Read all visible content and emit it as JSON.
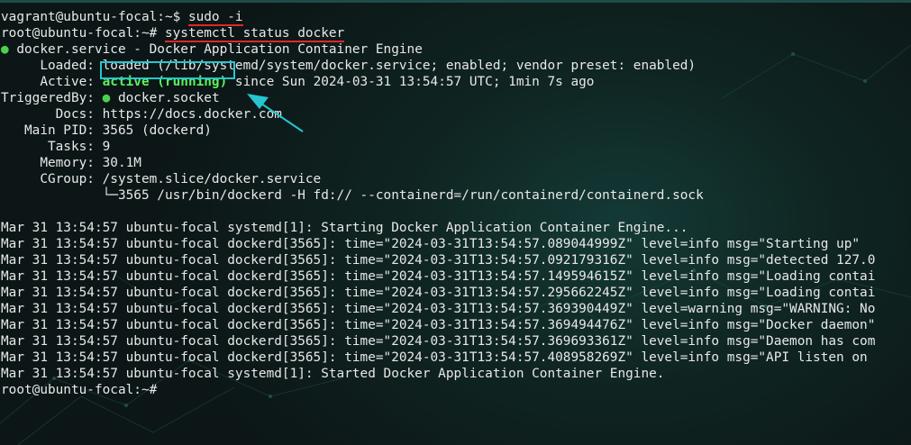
{
  "terminal": {
    "lines": [
      {
        "prompt": "vagrant@ubuntu-focal:~$ ",
        "cmd": "sudo -i"
      },
      {
        "prompt": "root@ubuntu-focal:~# ",
        "cmd": "systemctl status docker"
      },
      {
        "bullet": "●",
        "text": " docker.service - Docker Application Container Engine"
      },
      {
        "text": "     Loaded: loaded (/lib/systemd/system/docker.service; enabled; vendor preset: enabled)"
      },
      {
        "label": "     Active: ",
        "status": "active (running)",
        "text": " since Sun 2024-03-31 13:54:57 UTC; 1min 7s ago"
      },
      {
        "label": "TriggeredBy: ",
        "bullet": "●",
        "text": " docker.socket"
      },
      {
        "text": "       Docs: https://docs.docker.com"
      },
      {
        "text": "   Main PID: 3565 (dockerd)"
      },
      {
        "text": "      Tasks: 9"
      },
      {
        "text": "     Memory: 30.1M"
      },
      {
        "text": "     CGroup: /system.slice/docker.service"
      },
      {
        "text": "             └─3565 /usr/bin/dockerd -H fd:// --containerd=/run/containerd/containerd.sock"
      },
      {
        "text": ""
      },
      {
        "text": "Mar 31 13:54:57 ubuntu-focal systemd[1]: Starting Docker Application Container Engine..."
      },
      {
        "text": "Mar 31 13:54:57 ubuntu-focal dockerd[3565]: time=\"2024-03-31T13:54:57.089044999Z\" level=info msg=\"Starting up\""
      },
      {
        "text": "Mar 31 13:54:57 ubuntu-focal dockerd[3565]: time=\"2024-03-31T13:54:57.092179316Z\" level=info msg=\"detected 127.0"
      },
      {
        "text": "Mar 31 13:54:57 ubuntu-focal dockerd[3565]: time=\"2024-03-31T13:54:57.149594615Z\" level=info msg=\"Loading contai"
      },
      {
        "text": "Mar 31 13:54:57 ubuntu-focal dockerd[3565]: time=\"2024-03-31T13:54:57.295662245Z\" level=info msg=\"Loading contai"
      },
      {
        "text": "Mar 31 13:54:57 ubuntu-focal dockerd[3565]: time=\"2024-03-31T13:54:57.369390449Z\" level=warning msg=\"WARNING: No"
      },
      {
        "text": "Mar 31 13:54:57 ubuntu-focal dockerd[3565]: time=\"2024-03-31T13:54:57.369494476Z\" level=info msg=\"Docker daemon\""
      },
      {
        "text": "Mar 31 13:54:57 ubuntu-focal dockerd[3565]: time=\"2024-03-31T13:54:57.369693361Z\" level=info msg=\"Daemon has com"
      },
      {
        "text": "Mar 31 13:54:57 ubuntu-focal dockerd[3565]: time=\"2024-03-31T13:54:57.408958269Z\" level=info msg=\"API listen on "
      },
      {
        "text": "Mar 31 13:54:57 ubuntu-focal systemd[1]: Started Docker Application Container Engine."
      },
      {
        "prompt": "root@ubuntu-focal:~# ",
        "cursor": "true"
      }
    ]
  },
  "colors": {
    "status_green": "#5ef05e",
    "bullet_green": "#4cd14c",
    "highlight_box": "#25c6cf",
    "underline_red": "#e0262a",
    "arrow": "#25c6cf"
  },
  "icons": {
    "bullet": "status-dot-icon",
    "arrow": "annotation-arrow-icon",
    "cursor": "block-cursor-icon"
  }
}
